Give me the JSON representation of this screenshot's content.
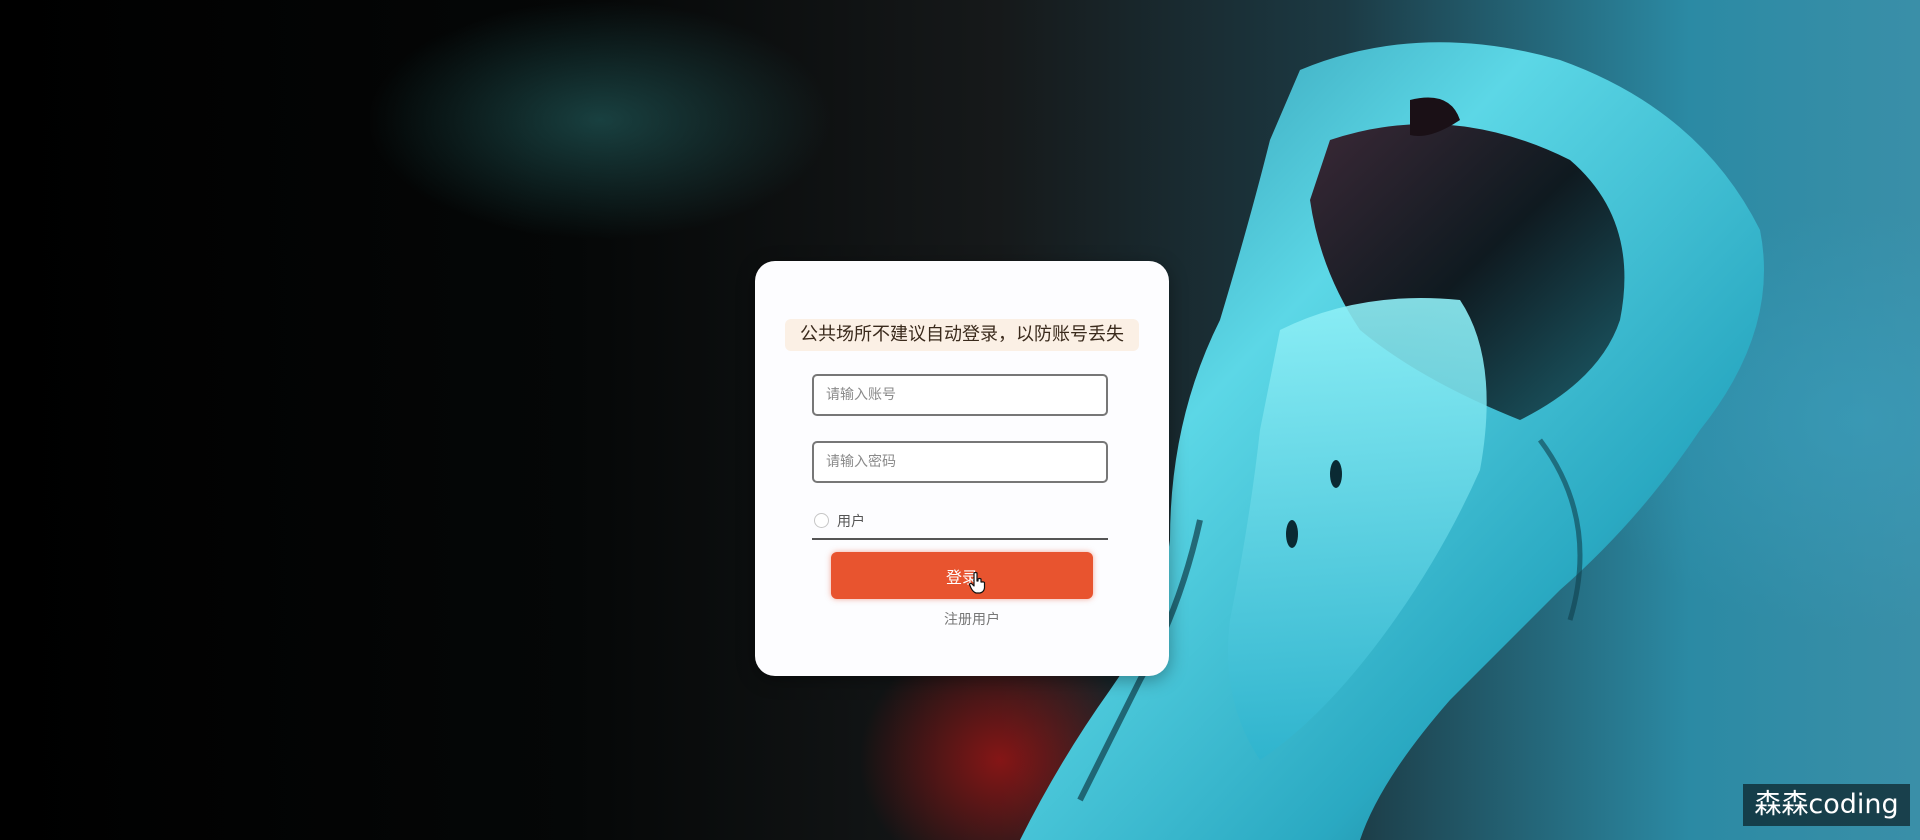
{
  "notice": {
    "text": "公共场所不建议自动登录，以防账号丢失"
  },
  "form": {
    "account_placeholder": "请输入账号",
    "password_placeholder": "请输入密码",
    "role_label": "用户",
    "login_label": "登录",
    "register_label": "注册用户"
  },
  "watermark": {
    "text": "森森coding"
  },
  "colors": {
    "login_button": "#e8542f",
    "notice_background": "#fbf0e5",
    "card_background": "#fdfdff"
  },
  "icons": [
    "car-background-image",
    "radio-icon",
    "hand-pointer-icon"
  ]
}
